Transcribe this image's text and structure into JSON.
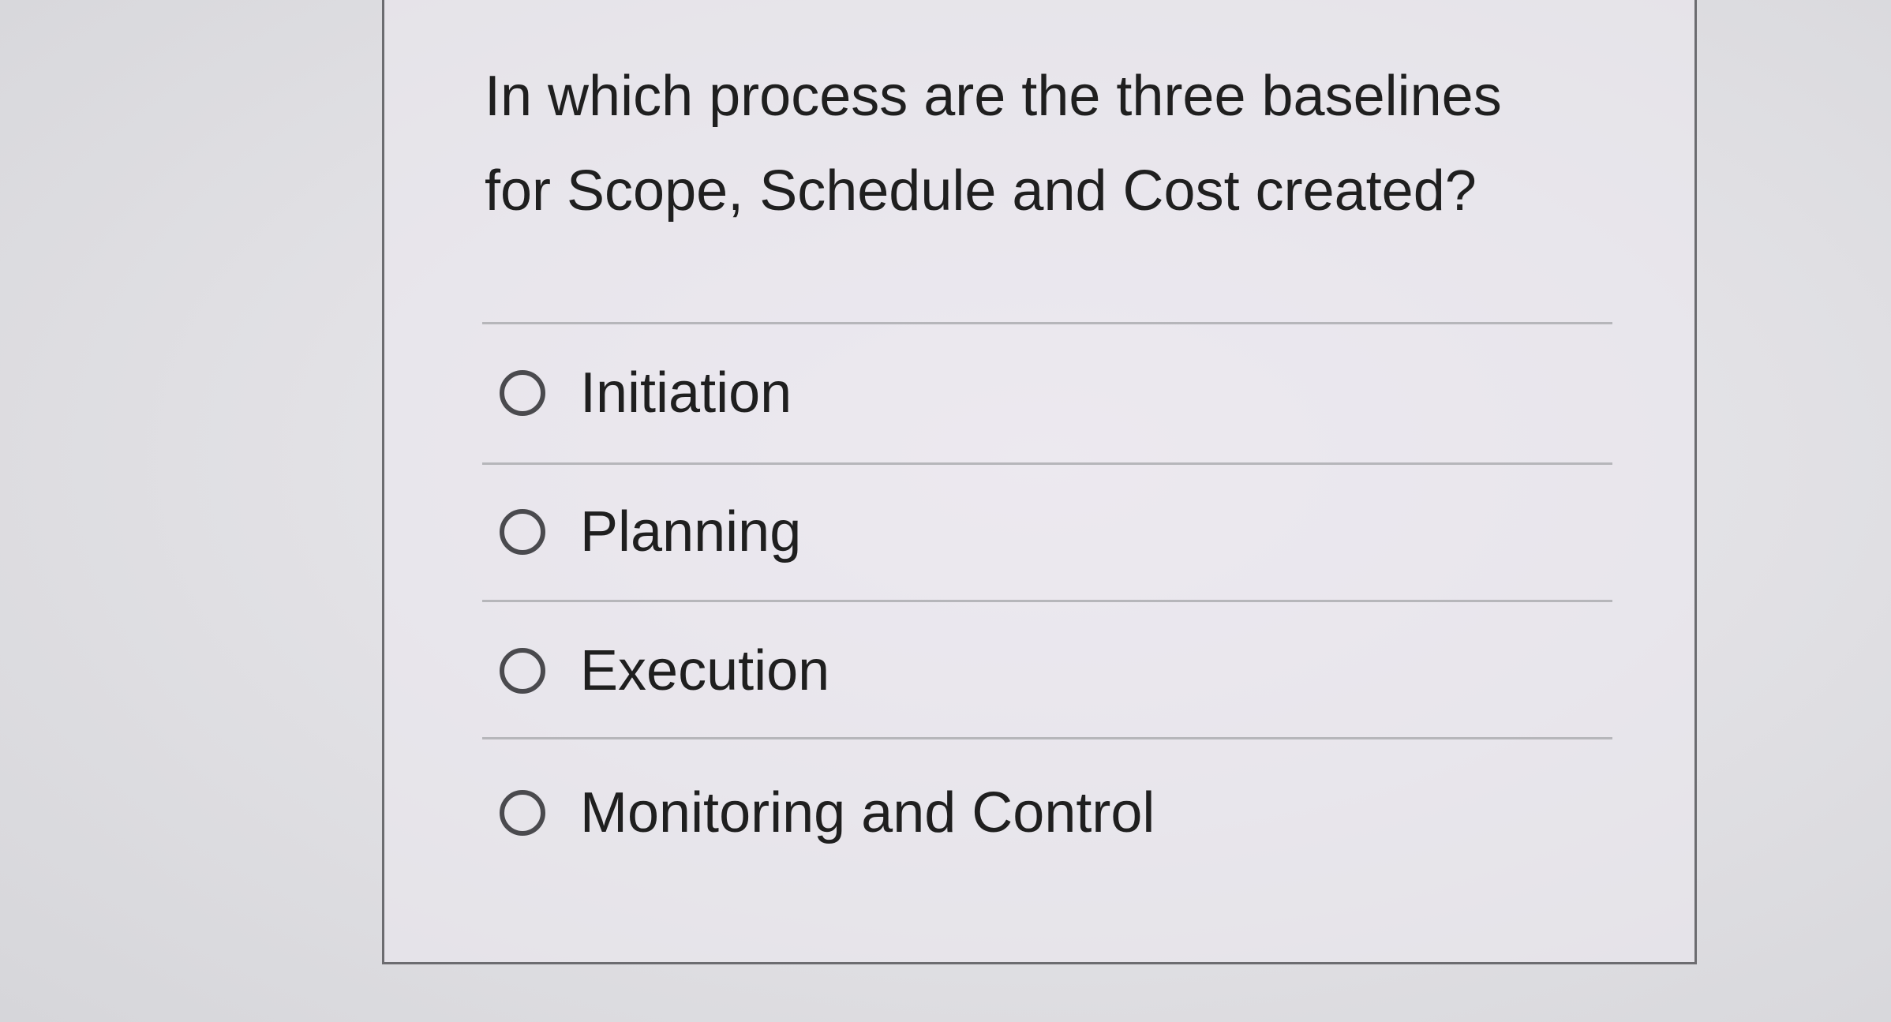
{
  "question": {
    "line1": "In which process are the three baselines",
    "line2": "for Scope, Schedule and Cost created?"
  },
  "options": [
    {
      "label": "Initiation",
      "selected": false
    },
    {
      "label": "Planning",
      "selected": false
    },
    {
      "label": "Execution",
      "selected": false
    },
    {
      "label": "Monitoring and Control",
      "selected": false
    }
  ]
}
